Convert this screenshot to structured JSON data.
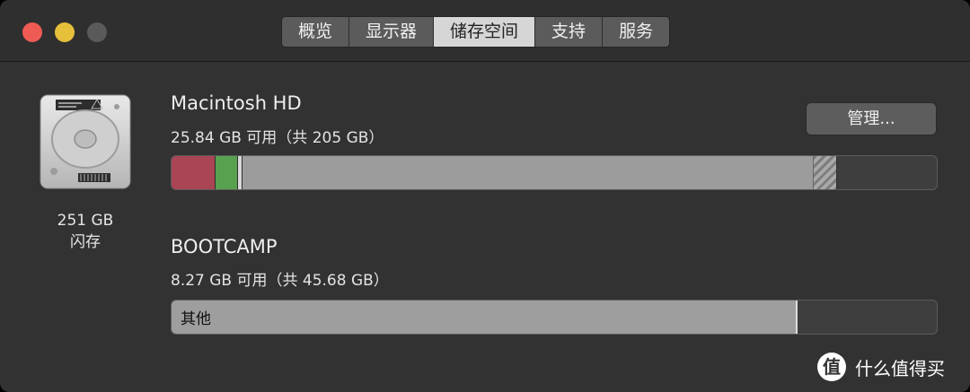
{
  "tabs": [
    {
      "label": "概览"
    },
    {
      "label": "显示器"
    },
    {
      "label": "储存空间",
      "active": true
    },
    {
      "label": "支持"
    },
    {
      "label": "服务"
    }
  ],
  "disk": {
    "icon": "hard-drive-icon",
    "size": "251 GB",
    "type": "闪存"
  },
  "volumes": [
    {
      "name": "Macintosh HD",
      "info": "25.84 GB 可用（共 205 GB）",
      "manage_label": "管理...",
      "usage_fractions": {
        "apps": 0.058,
        "documents": 0.029,
        "system": 0.006,
        "other": 0.746,
        "purgeable": 0.03,
        "free": 0.131
      }
    },
    {
      "name": "BOOTCAMP",
      "info": "8.27 GB 可用（共 45.68 GB）",
      "segment_label": "其他",
      "usage_fractions": {
        "other": 0.818,
        "free": 0.182
      }
    }
  ],
  "watermark": {
    "glyph": "值",
    "text": "什么值得买"
  },
  "colors": {
    "apps": "#aa4556",
    "documents": "#57a14f",
    "system": "#d8d8d8",
    "other": "#9c9c9c",
    "free": "#3e3e3e",
    "close": "#ee5b55",
    "minimize": "#e6bf3b"
  }
}
